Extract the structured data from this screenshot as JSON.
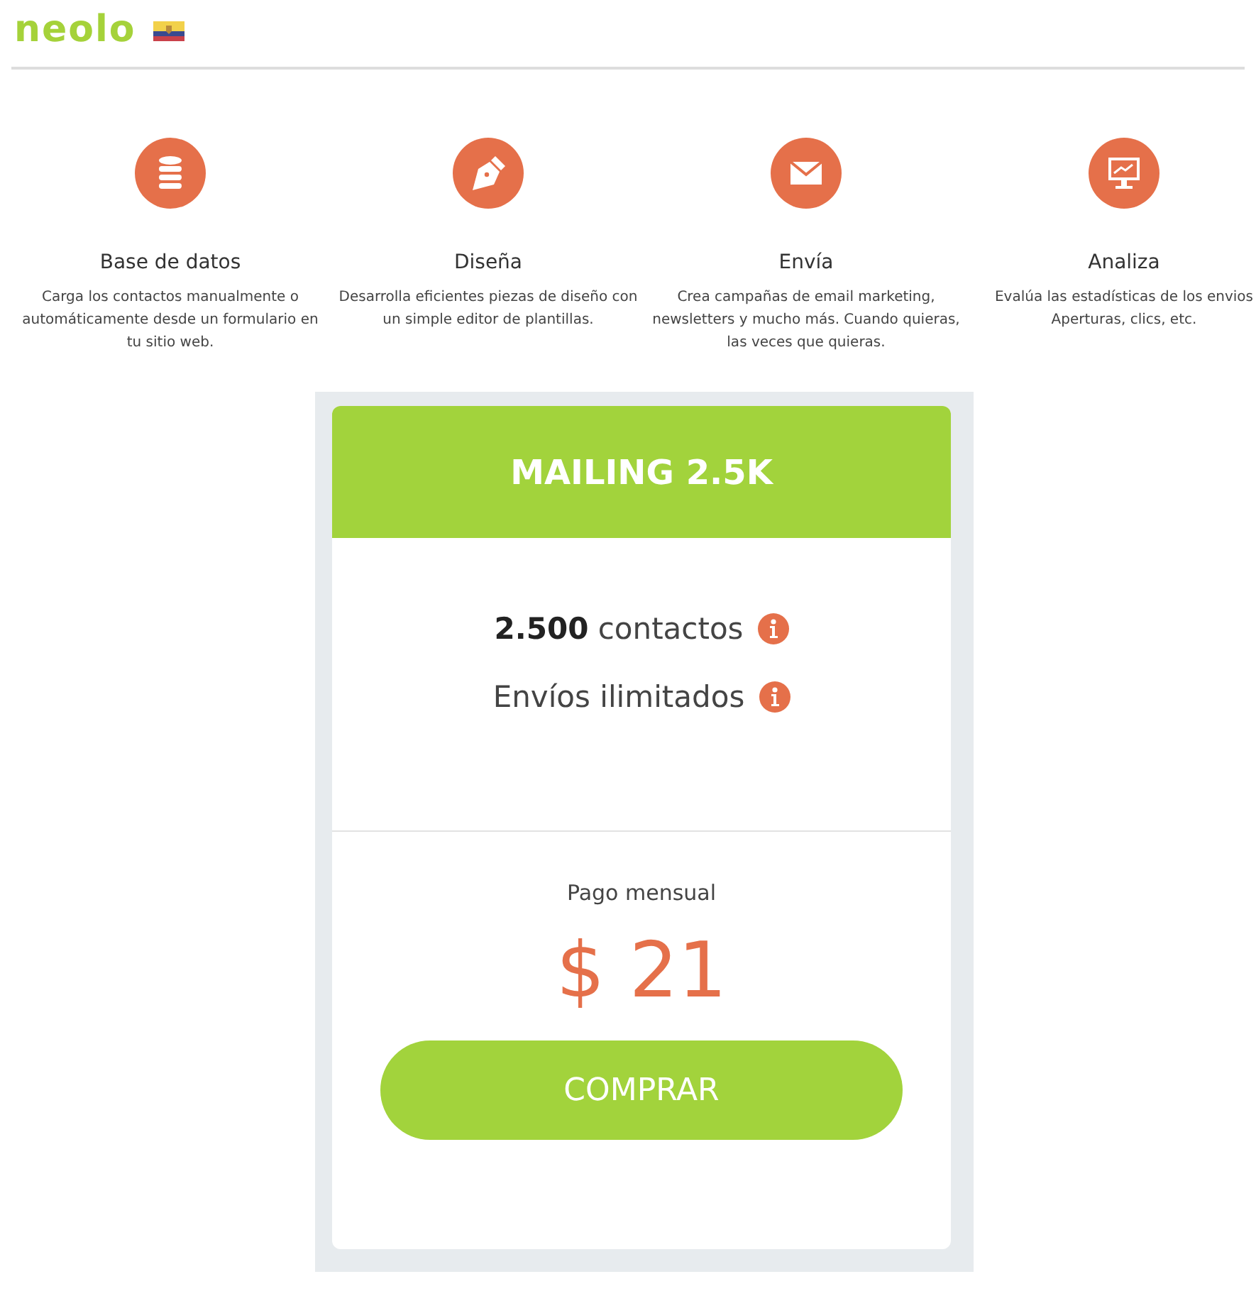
{
  "header": {
    "logo": "neolo"
  },
  "features": [
    {
      "title": "Base de datos",
      "text": "Carga los contactos manualmente o automáticamente desde un formulario en tu sitio web."
    },
    {
      "title": "Diseña",
      "text": "Desarrolla eficientes piezas de diseño con un simple editor de plantillas."
    },
    {
      "title": "Envía",
      "text": "Crea campañas de email marketing, newsletters y mucho más. Cuando quieras, las veces que quieras."
    },
    {
      "title": "Analiza",
      "text": "Evalúa las estadísticas de los envios Aperturas, clics, etc."
    }
  ],
  "plan": {
    "name": "MAILING 2.5K",
    "features": [
      "**2.500** contactos",
      "Envíos ilimitados"
    ],
    "period": "Pago mensual",
    "price": "$ 21",
    "button": "COMPRAR"
  }
}
